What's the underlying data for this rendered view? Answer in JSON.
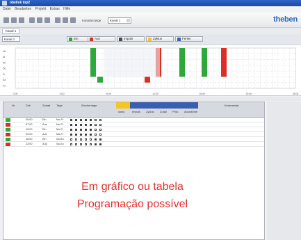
{
  "window": {
    "title": "obelisk top2"
  },
  "menu": {
    "items": [
      "Datei",
      "Bearbeiten",
      "Projekt",
      "Extras",
      "Hilfe"
    ]
  },
  "toolbar": {
    "channel_label": "Kanalanzeige",
    "channel_value": "Kanal 1"
  },
  "logo": {
    "text": "theben"
  },
  "subtab": {
    "label": "Kanal 1"
  },
  "control": {
    "dropdown": "Kanal 1",
    "buttons": [
      {
        "label": "Ein",
        "color": "#2ea83a"
      },
      {
        "label": "Aus",
        "color": "#d93025"
      },
      {
        "label": "Impuls",
        "color": "#4a4a4a"
      },
      {
        "label": "Zyklus",
        "color": "#f2c12e"
      },
      {
        "label": "Ferien",
        "color": "#3a5fb0"
      }
    ]
  },
  "schedule_chart": {
    "time_labels": [
      "0:00",
      "4:00",
      "8:00",
      "12:00",
      "16:00",
      "20:00",
      "24:00"
    ],
    "row_labels": [
      "Mo",
      "Di",
      "Mi",
      "Do",
      "Fr",
      "Sa",
      "So"
    ],
    "colors": {
      "on": "#2ea83a",
      "off": "#d93025"
    }
  },
  "table": {
    "headers": [
      "Nr",
      "Zeit",
      "Schalt.",
      "Tage",
      "Wochentage",
      "Astro",
      "Impuls",
      "Zyklus",
      "Zufall",
      "Prior.",
      "Ausnahme",
      "Kommentar"
    ],
    "rows": [
      {
        "status": "on",
        "time": "05:00",
        "action": "Ein",
        "day": "Mo-Fr",
        "days": [
          1,
          1,
          1,
          1,
          1,
          0,
          0
        ]
      },
      {
        "status": "off",
        "time": "07:00",
        "action": "Aus",
        "day": "Mo-Fr",
        "days": [
          1,
          1,
          1,
          1,
          1,
          0,
          0
        ]
      },
      {
        "status": "on",
        "time": "15:00",
        "action": "Ein",
        "day": "Mo-Fr",
        "days": [
          1,
          1,
          1,
          1,
          1,
          0,
          0
        ]
      },
      {
        "status": "off",
        "time": "20:00",
        "action": "Aus",
        "day": "Mo-Fr",
        "days": [
          1,
          1,
          1,
          1,
          1,
          0,
          0
        ]
      },
      {
        "status": "on",
        "time": "18:00",
        "action": "Ein",
        "day": "Sa-So",
        "days": [
          0,
          0,
          0,
          0,
          0,
          1,
          1
        ]
      },
      {
        "status": "off",
        "time": "22:00",
        "action": "Aus",
        "day": "Sa-So",
        "days": [
          0,
          0,
          0,
          0,
          0,
          1,
          1
        ]
      }
    ]
  },
  "caption": {
    "line1": "Em gráfico ou tabela",
    "line2": "Programação possível"
  }
}
